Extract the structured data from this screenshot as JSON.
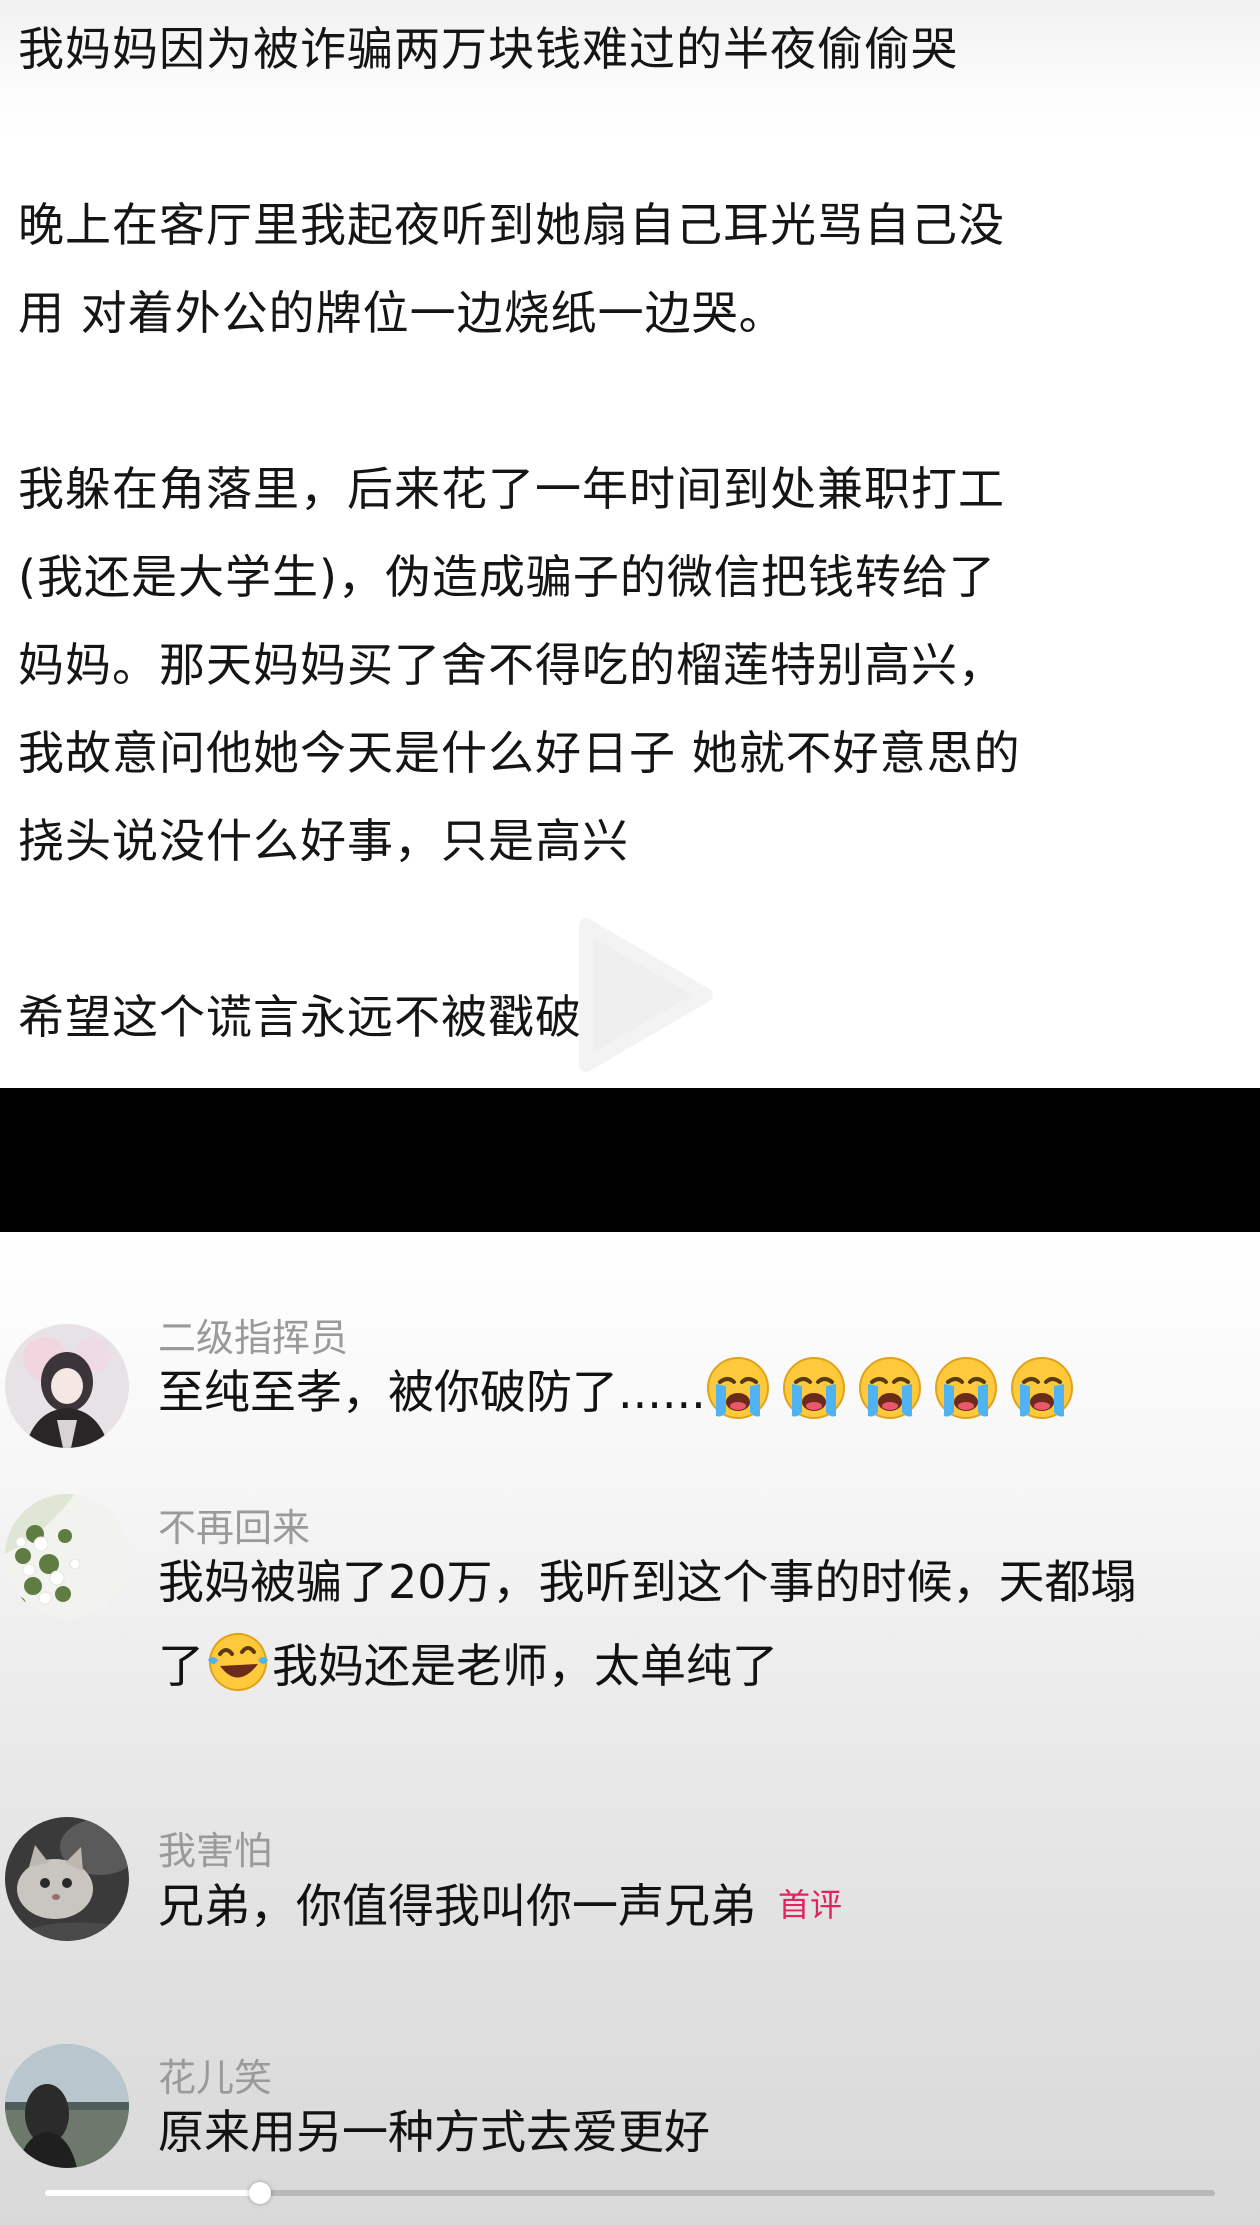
{
  "post": {
    "lines": [
      "我妈妈因为被诈骗两万块钱难过的半夜偷偷哭",
      "",
      "晚上在客厅里我起夜听到她扇自己耳光骂自己没",
      "用 对着外公的牌位一边烧纸一边哭。",
      "",
      "我躲在角落里，后来花了一年时间到处兼职打工",
      "(我还是大学生)，伪造成骗子的微信把钱转给了",
      "妈妈。那天妈妈买了舍不得吃的榴莲特别高兴，",
      "我故意问他她今天是什么好日子 她就不好意思的",
      "挠头说没什么好事，只是高兴",
      "",
      "希望这个谎言永远不被戳破"
    ]
  },
  "comments": [
    {
      "username": "二级指挥员",
      "text": "至纯至孝，被你破防了......",
      "emoji_count": 5,
      "emoji_icon": "loudly-crying-face-icon"
    },
    {
      "username": "不再回来",
      "text_line1": "我妈被骗了20万，我听到这个事的时候，天都塌",
      "text_line2_pre": "了",
      "text_line2_post": "我妈还是老师，太单纯了",
      "emoji_icon": "tears-of-joy-face-icon"
    },
    {
      "username": "我害怕",
      "text": "兄弟，你值得我叫你一声兄弟",
      "badge": "首评"
    },
    {
      "username": "花儿笑",
      "text": "原来用另一种方式去爱更好"
    }
  ],
  "video": {
    "progress": 0.184
  },
  "colors": {
    "username": "#9a9a9a",
    "badge": "#e0245e",
    "bar": "#000000"
  }
}
